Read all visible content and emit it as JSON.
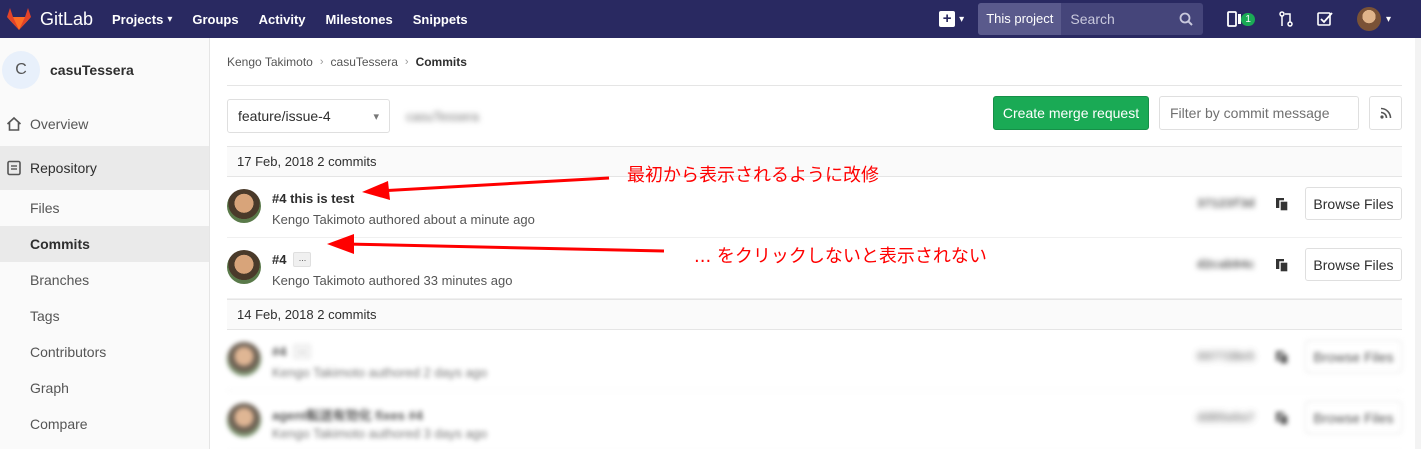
{
  "topbar": {
    "brand": "GitLab",
    "nav": [
      "Projects",
      "Groups",
      "Activity",
      "Milestones",
      "Snippets"
    ],
    "scope_label": "This project",
    "search_placeholder": "Search",
    "todo_count": "1"
  },
  "sidebar": {
    "project_initial": "C",
    "project_name": "casuTessera",
    "overview": "Overview",
    "repository": "Repository",
    "sub_items": [
      "Files",
      "Commits",
      "Branches",
      "Tags",
      "Contributors",
      "Graph",
      "Compare"
    ]
  },
  "breadcrumb": {
    "owner": "Kengo Takimoto",
    "project": "casuTessera",
    "current": "Commits"
  },
  "controls": {
    "branch": "feature/issue-4",
    "path": "casuTessera",
    "merge_button": "Create merge request",
    "filter_placeholder": "Filter by commit message"
  },
  "groups": [
    {
      "header": "17 Feb, 2018 2 commits",
      "commits": [
        {
          "title": "#4 this is test",
          "meta": "Kengo Takimoto authored about a minute ago",
          "sha": "37123f3d",
          "browse": "Browse Files",
          "has_ellipsis": false
        },
        {
          "title": "#4",
          "meta": "Kengo Takimoto authored 33 minutes ago",
          "sha": "d2cab94c",
          "browse": "Browse Files",
          "has_ellipsis": true
        }
      ]
    },
    {
      "header": "14 Feb, 2018 2 commits",
      "commits": [
        {
          "title": "#4",
          "meta": "Kengo Takimoto authored 2 days ago",
          "sha": "00772Be5",
          "browse": "Browse Files",
          "has_ellipsis": true
        },
        {
          "title": "agent転送有効化 fixes #4",
          "meta": "Kengo Takimoto authored 3 days ago",
          "sha": "dd85a6a7",
          "browse": "Browse Files",
          "has_ellipsis": false
        }
      ]
    }
  ],
  "ellipsis_label": "...",
  "annotations": {
    "first": "最初から表示されるように改修",
    "second": "... をクリックしないと表示されない"
  },
  "colors": {
    "nav_bg": "#292961",
    "merge_green": "#1aaa55",
    "annotation_red": "#ff0000"
  }
}
